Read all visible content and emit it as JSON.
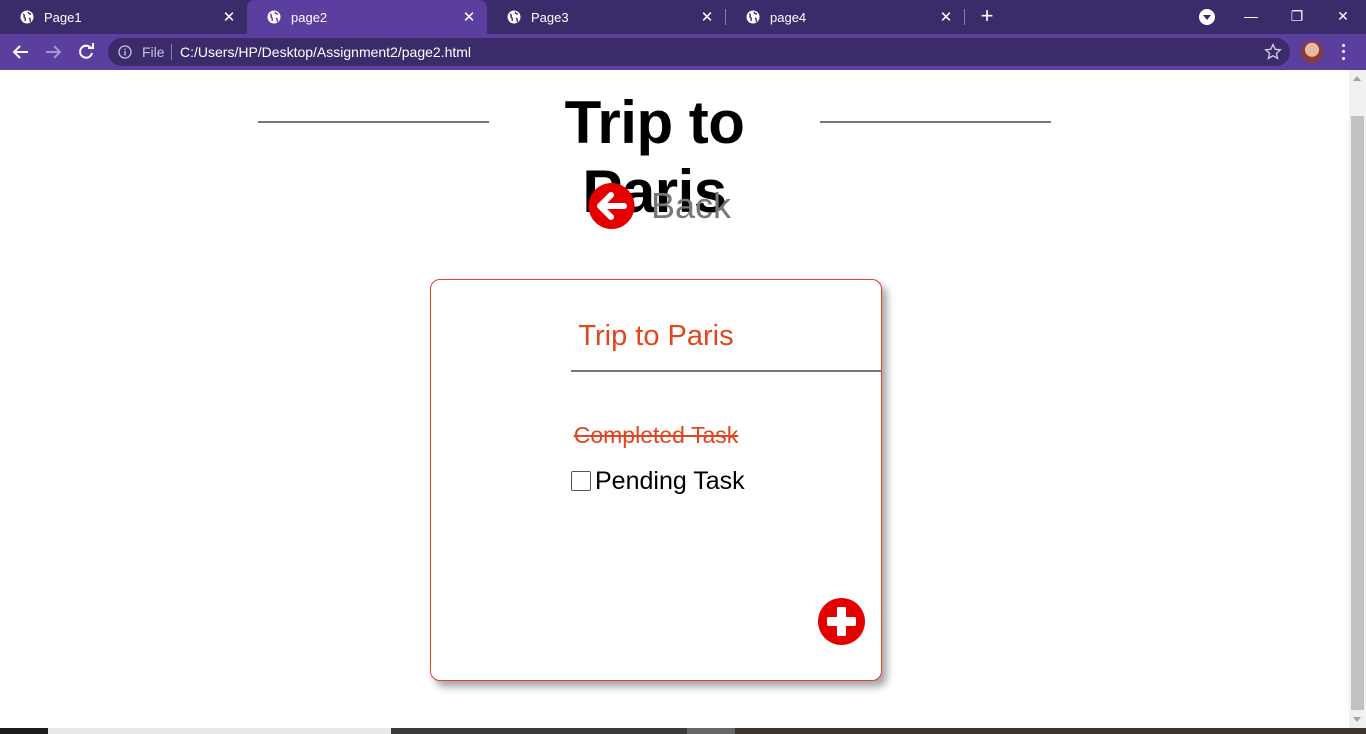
{
  "browser": {
    "tabs": [
      {
        "label": "Page1",
        "active": false
      },
      {
        "label": "page2",
        "active": true
      },
      {
        "label": "Page3",
        "active": false
      },
      {
        "label": "page4",
        "active": false
      }
    ],
    "new_tab_label": "+",
    "address": {
      "scheme_label": "File",
      "url": "C:/Users/HP/Desktop/Assignment2/page2.html"
    },
    "window_controls": {
      "minimize": "—",
      "restore": "❐",
      "close": "✕"
    }
  },
  "page": {
    "title": "Trip to Paris",
    "back_label": "Back",
    "card": {
      "title": "Trip to Paris",
      "tasks": [
        {
          "label": "Completed Task",
          "completed": true
        },
        {
          "label": "Pending Task",
          "completed": false
        }
      ]
    }
  },
  "colors": {
    "chrome_dark": "#3c2b6b",
    "chrome_light": "#5b3f9f",
    "accent_red": "#e50000",
    "accent_orange": "#e0461f",
    "muted_gray": "#777777"
  },
  "icons": [
    "globe-icon",
    "close-icon",
    "plus-icon",
    "tab-search-icon",
    "back-arrow-icon",
    "forward-arrow-icon",
    "reload-icon",
    "info-icon",
    "star-icon",
    "profile-avatar",
    "menu-icon",
    "back-circle-icon",
    "add-circle-icon"
  ]
}
